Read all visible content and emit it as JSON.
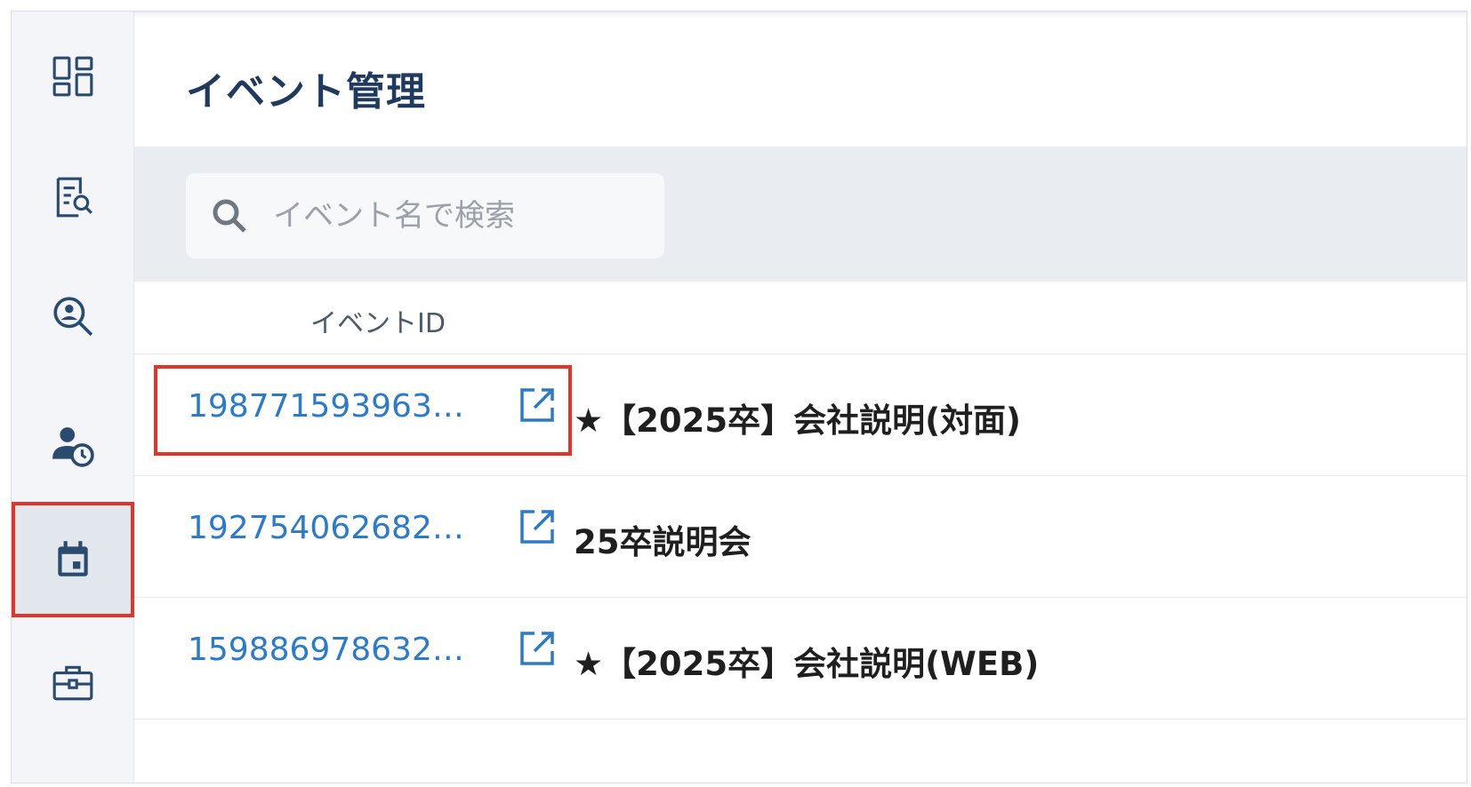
{
  "header": {
    "title": "イベント管理"
  },
  "sidebar": {
    "items": [
      {
        "icon": "dashboard-icon"
      },
      {
        "icon": "document-search-icon"
      },
      {
        "icon": "person-search-icon"
      },
      {
        "icon": "person-clock-icon"
      },
      {
        "icon": "calendar-icon",
        "active": true
      },
      {
        "icon": "briefcase-icon"
      }
    ]
  },
  "search": {
    "placeholder": "イベント名で検索"
  },
  "table": {
    "column_event_id": "イベントID",
    "rows": [
      {
        "id": "198771593963…",
        "name": "★【2025卒】会社説明(対面)",
        "highlighted": true
      },
      {
        "id": "192754062682…",
        "name": "25卒説明会",
        "highlighted": false
      },
      {
        "id": "159886978632…",
        "name": "★【2025卒】会社説明(WEB)",
        "highlighted": false
      }
    ]
  },
  "colors": {
    "title": "#1f3a5c",
    "link": "#2f7ac4",
    "highlight_border": "#e0352b",
    "sidebar_bg": "#f3f5f8",
    "search_area_bg": "#e9edf1"
  }
}
